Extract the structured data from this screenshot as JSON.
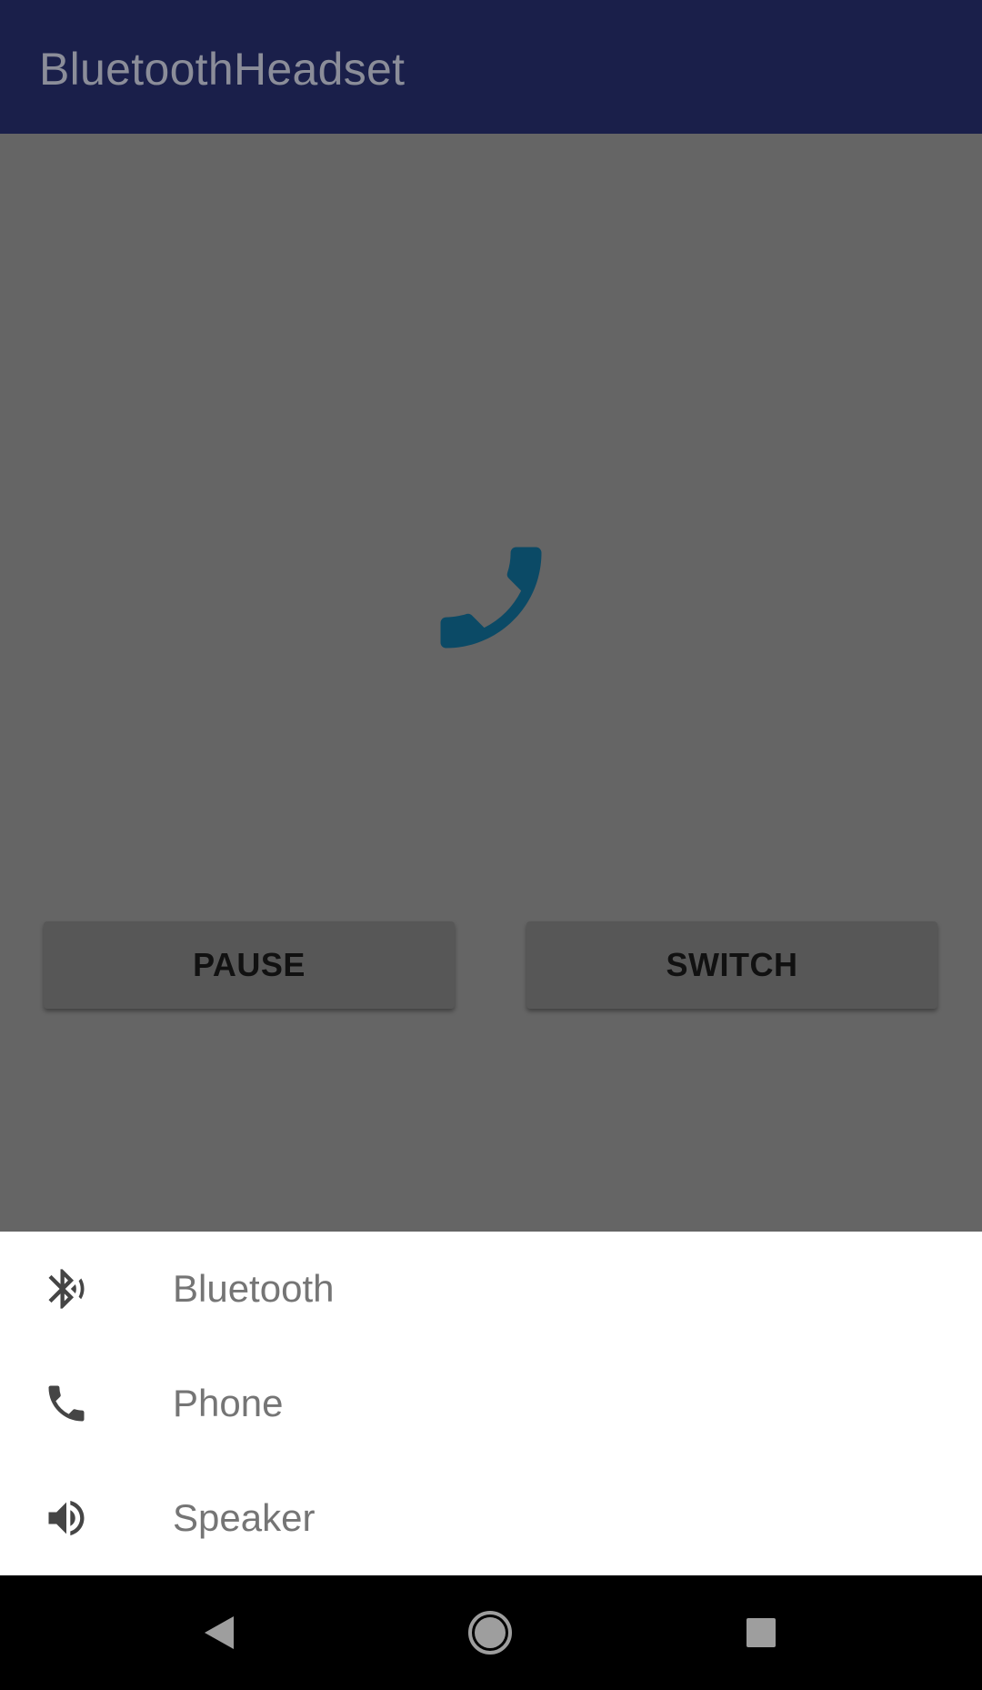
{
  "app_bar": {
    "title": "BluetoothHeadset",
    "color": "#1a1f4a"
  },
  "main": {
    "call_icon": "phone-icon",
    "call_icon_color": "#0b4a66",
    "pause_label": "PAUSE",
    "switch_label": "SWITCH"
  },
  "audio_sheet": {
    "items": [
      {
        "icon": "bluetooth-audio-icon",
        "label": "Bluetooth"
      },
      {
        "icon": "phone-icon",
        "label": "Phone"
      },
      {
        "icon": "speaker-icon",
        "label": "Speaker"
      }
    ]
  },
  "nav_bar": {
    "back_icon": "back-triangle-icon",
    "home_icon": "home-circle-icon",
    "recents_icon": "recents-square-icon"
  }
}
